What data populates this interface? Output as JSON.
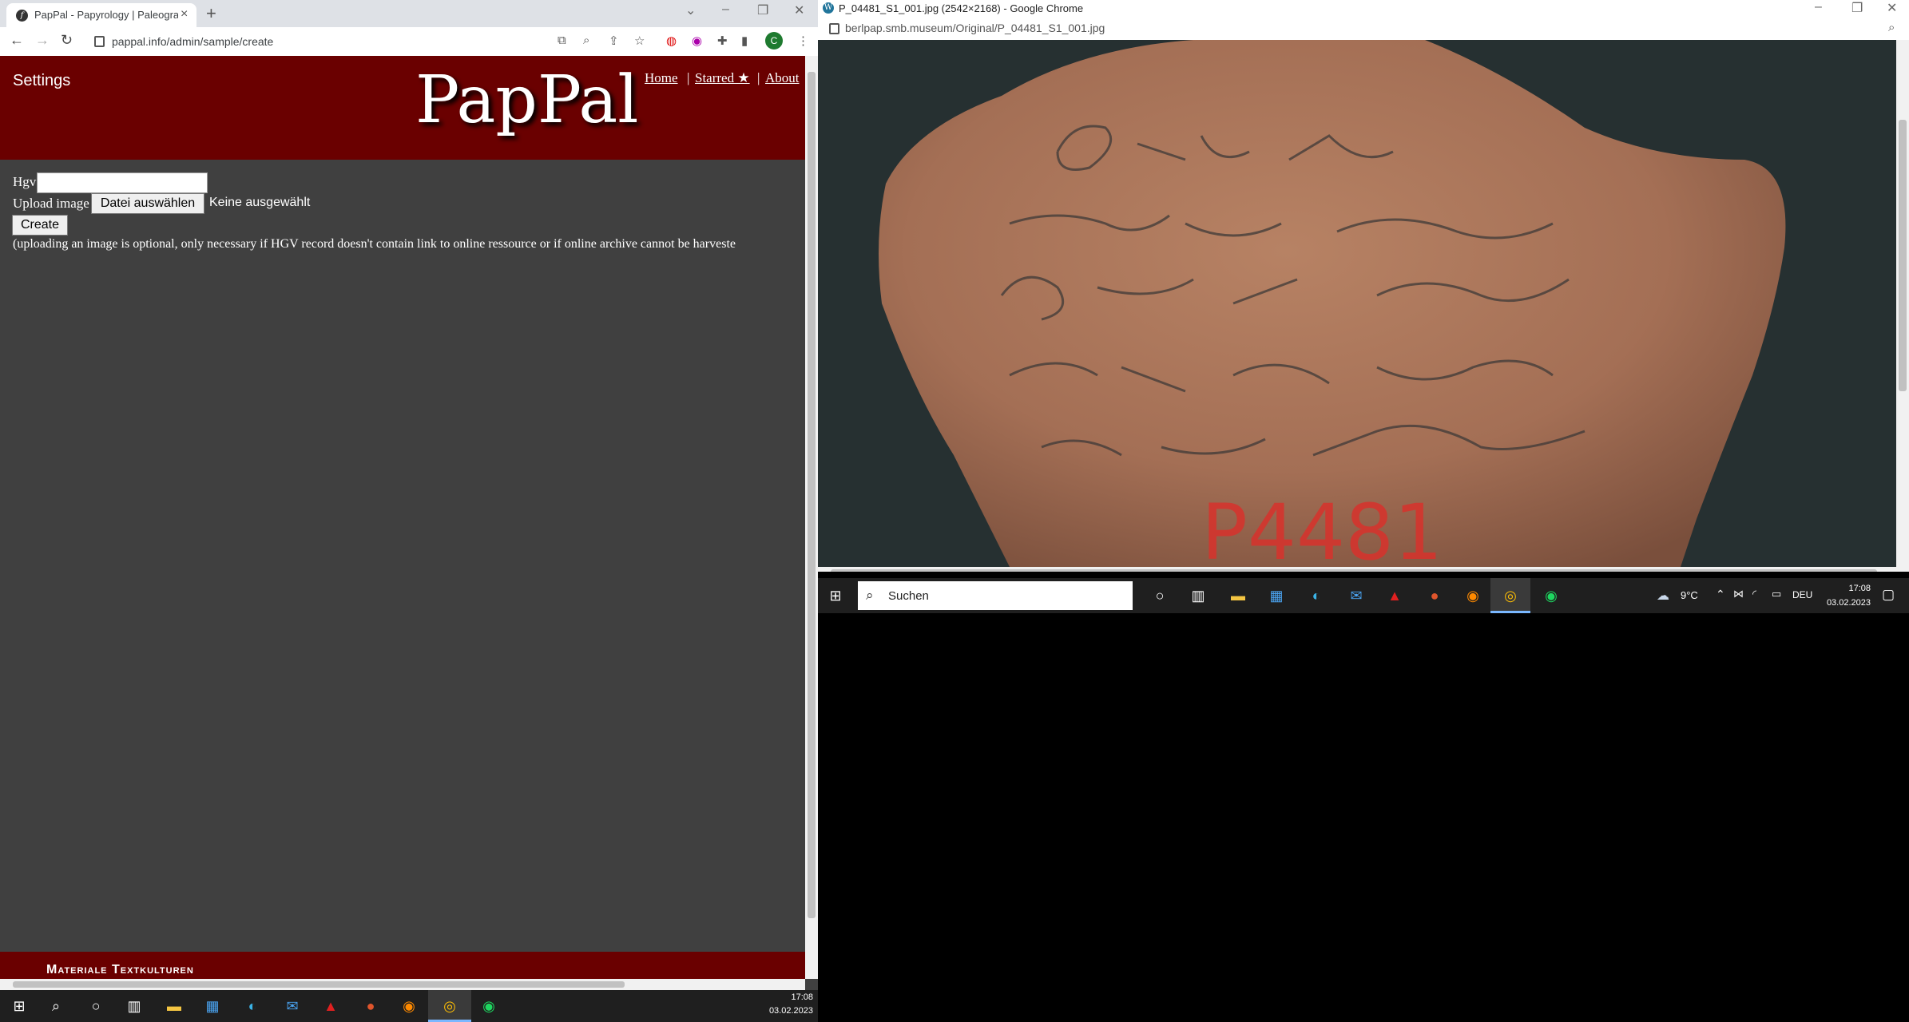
{
  "left_browser": {
    "tab_title": "PapPal - Papyrology | Paleograph",
    "url": "pappal.info/admin/sample/create",
    "profile_initial": "C"
  },
  "pappal": {
    "settings_label": "Settings",
    "brand": "PapPal",
    "nav": {
      "home": "Home",
      "starred": "Starred ★",
      "about": "About",
      "separator": "|"
    },
    "form": {
      "hgv_label": "Hgv",
      "hgv_value": "",
      "upload_label": "Upload image",
      "file_button": "Datei auswählen",
      "no_file": "Keine ausgewählt",
      "create_button": "Create",
      "note": "(uploading an image is optional, only necessary if HGV record doesn't contain link to online ressource or if online archive cannot be harveste"
    },
    "footer_text": "Materiale Textkulturen"
  },
  "left_taskbar": {
    "time": "17:08",
    "date": "03.02.2023"
  },
  "right_browser": {
    "window_title": "P_04481_S1_001.jpg (2542×2168) - Google Chrome",
    "url": "berlpap.smb.museum/Original/P_04481_S1_001.jpg",
    "image_label": "P4481"
  },
  "right_taskbar": {
    "search_label": "Suchen",
    "weather": "9°C",
    "language": "DEU",
    "time": "17:08",
    "date": "03.02.2023"
  },
  "colors": {
    "header_bg": "#6a0000",
    "content_bg": "#404040",
    "taskbar_bg": "#1f1f1f"
  }
}
